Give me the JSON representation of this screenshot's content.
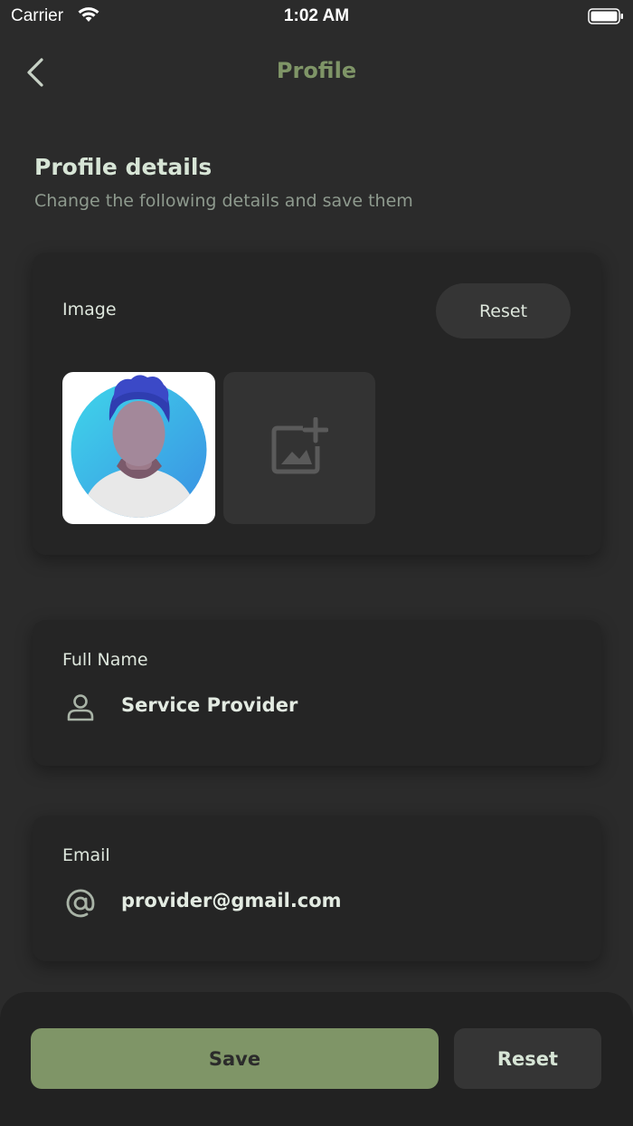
{
  "status_bar": {
    "carrier": "Carrier",
    "time": "1:02 AM"
  },
  "nav": {
    "title": "Profile",
    "back_icon": "chevron-left-icon"
  },
  "header": {
    "title": "Profile details",
    "subtitle": "Change the following details and save them"
  },
  "image_card": {
    "label": "Image",
    "reset_label": "Reset",
    "add_icon": "add-photo-icon"
  },
  "name_card": {
    "label": "Full Name",
    "value": "Service Provider",
    "icon": "person-icon"
  },
  "email_card": {
    "label": "Email",
    "value": "provider@gmail.com",
    "icon": "at-sign-icon"
  },
  "actions": {
    "save_label": "Save",
    "reset_label": "Reset"
  },
  "colors": {
    "accent": "#7f9567",
    "background": "#2b2b2b",
    "card": "#252525",
    "text_primary": "#d7e5d6"
  }
}
